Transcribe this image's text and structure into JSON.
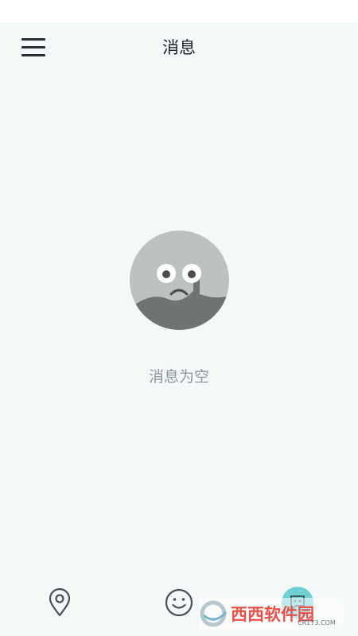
{
  "header": {
    "title": "消息"
  },
  "empty_state": {
    "message": "消息为空"
  },
  "bottom_nav": {
    "items": [
      {
        "icon": "location-pin-icon"
      },
      {
        "icon": "smiley-face-icon"
      },
      {
        "icon": "chat-bubble-icon"
      }
    ]
  },
  "watermark": {
    "brand": "西西软件园",
    "domain": "CR173.COM"
  },
  "colors": {
    "background": "#f3f8f9",
    "title_text": "#1e2225",
    "empty_text": "#8e959a",
    "face_gray": "#bdc2c1",
    "face_dark": "#6f7472",
    "accent_teal": "#6fd0d4"
  }
}
